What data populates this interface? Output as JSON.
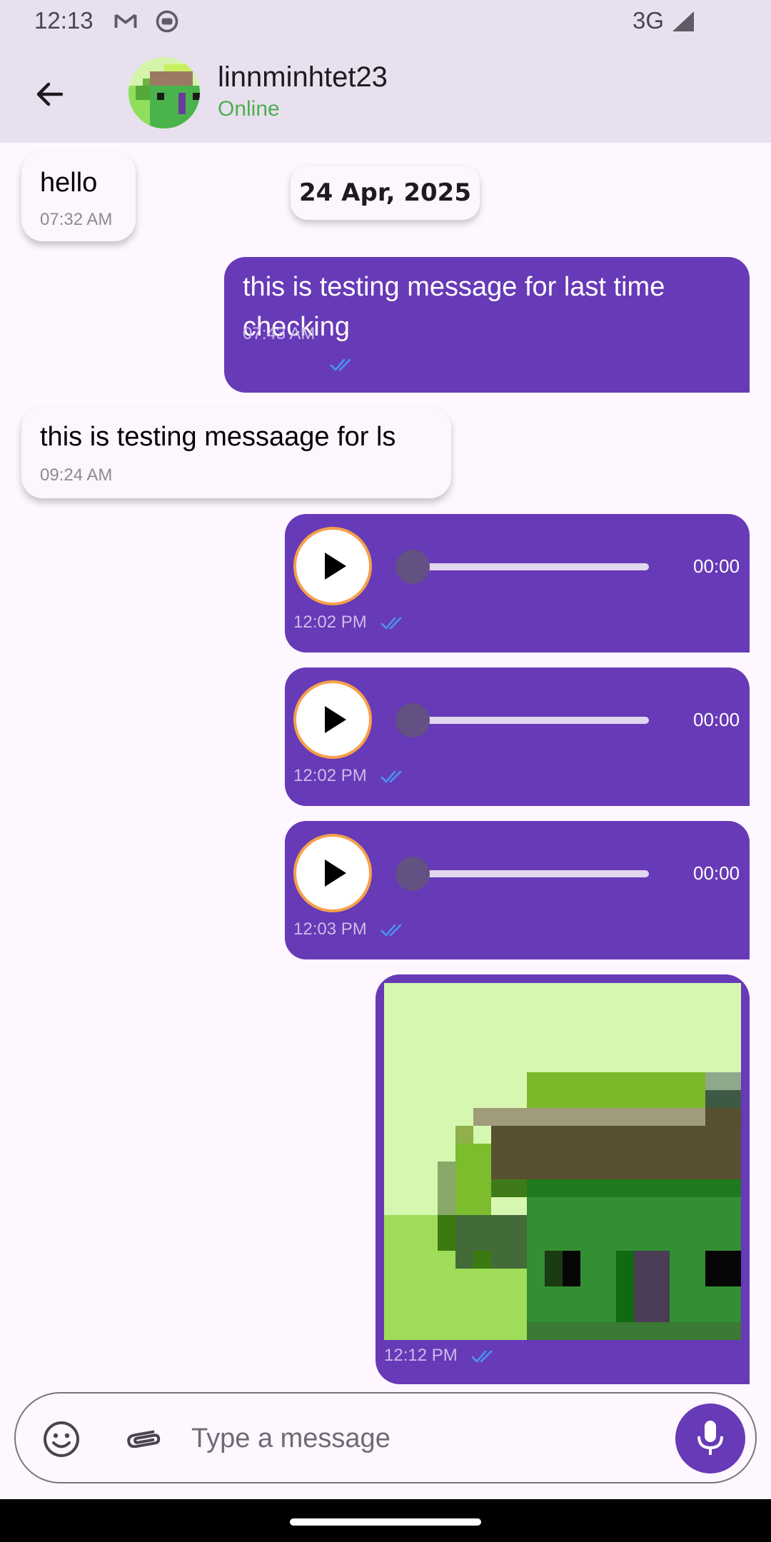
{
  "status_bar": {
    "time": "12:13",
    "network": "3G",
    "icons": [
      "gmail-icon",
      "app-notification-icon",
      "signal-icon"
    ]
  },
  "header": {
    "back_icon": "arrow-back-icon",
    "name": "linnminhtet23",
    "status": "Online",
    "status_color": "#4caf50"
  },
  "date_chip": "24 Apr, 2025",
  "messages": [
    {
      "direction": "incoming",
      "type": "text",
      "text": "hello",
      "time": "07:32 AM"
    },
    {
      "direction": "outgoing",
      "type": "text",
      "text_line1": "this is testing message for last time",
      "text_line2": "checking",
      "time": "07:43 AM",
      "read": true
    },
    {
      "direction": "incoming",
      "type": "text",
      "text": "this is testing messaage for ls",
      "time": "09:24 AM"
    },
    {
      "direction": "outgoing",
      "type": "voice",
      "duration": "00:00",
      "time": "12:02 PM",
      "read": true,
      "progress": 0
    },
    {
      "direction": "outgoing",
      "type": "voice",
      "duration": "00:00",
      "time": "12:02 PM",
      "read": true,
      "progress": 0
    },
    {
      "direction": "outgoing",
      "type": "voice",
      "duration": "00:00",
      "time": "12:03 PM",
      "read": true,
      "progress": 0
    },
    {
      "direction": "outgoing",
      "type": "image",
      "time": "12:12 PM",
      "read": true
    }
  ],
  "composer": {
    "placeholder": "Type a message",
    "emoji_icon": "emoji-icon",
    "attach_icon": "attach-icon",
    "mic_icon": "mic-icon"
  },
  "colors": {
    "accent": "#673ab7",
    "app_bar": "#e8e0ee",
    "background": "#fef7ff",
    "read_ticks": "#4d8ef0",
    "play_ring": "#f6a04a"
  }
}
